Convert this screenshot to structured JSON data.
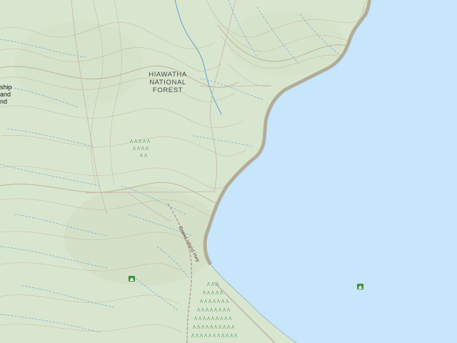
{
  "map": {
    "forest_label": [
      "HIAWATHA",
      "NATIONAL",
      "FOREST"
    ],
    "edge_label": [
      "ship",
      "and",
      "nd"
    ],
    "road_label": "Grand Island Hwy",
    "colors": {
      "land": "#d9e6cf",
      "water": "#c7e5fb",
      "contour": "#bfae8e",
      "contour_index": "#a88f6c",
      "stream": "#7bb0d6",
      "road": "#c9b8b8",
      "cliff": "#b19c7a",
      "vegetation": "#5c9a5c",
      "campsite": "#3f8f3f"
    },
    "icons": [
      "campground-icon",
      "campground-icon"
    ]
  }
}
